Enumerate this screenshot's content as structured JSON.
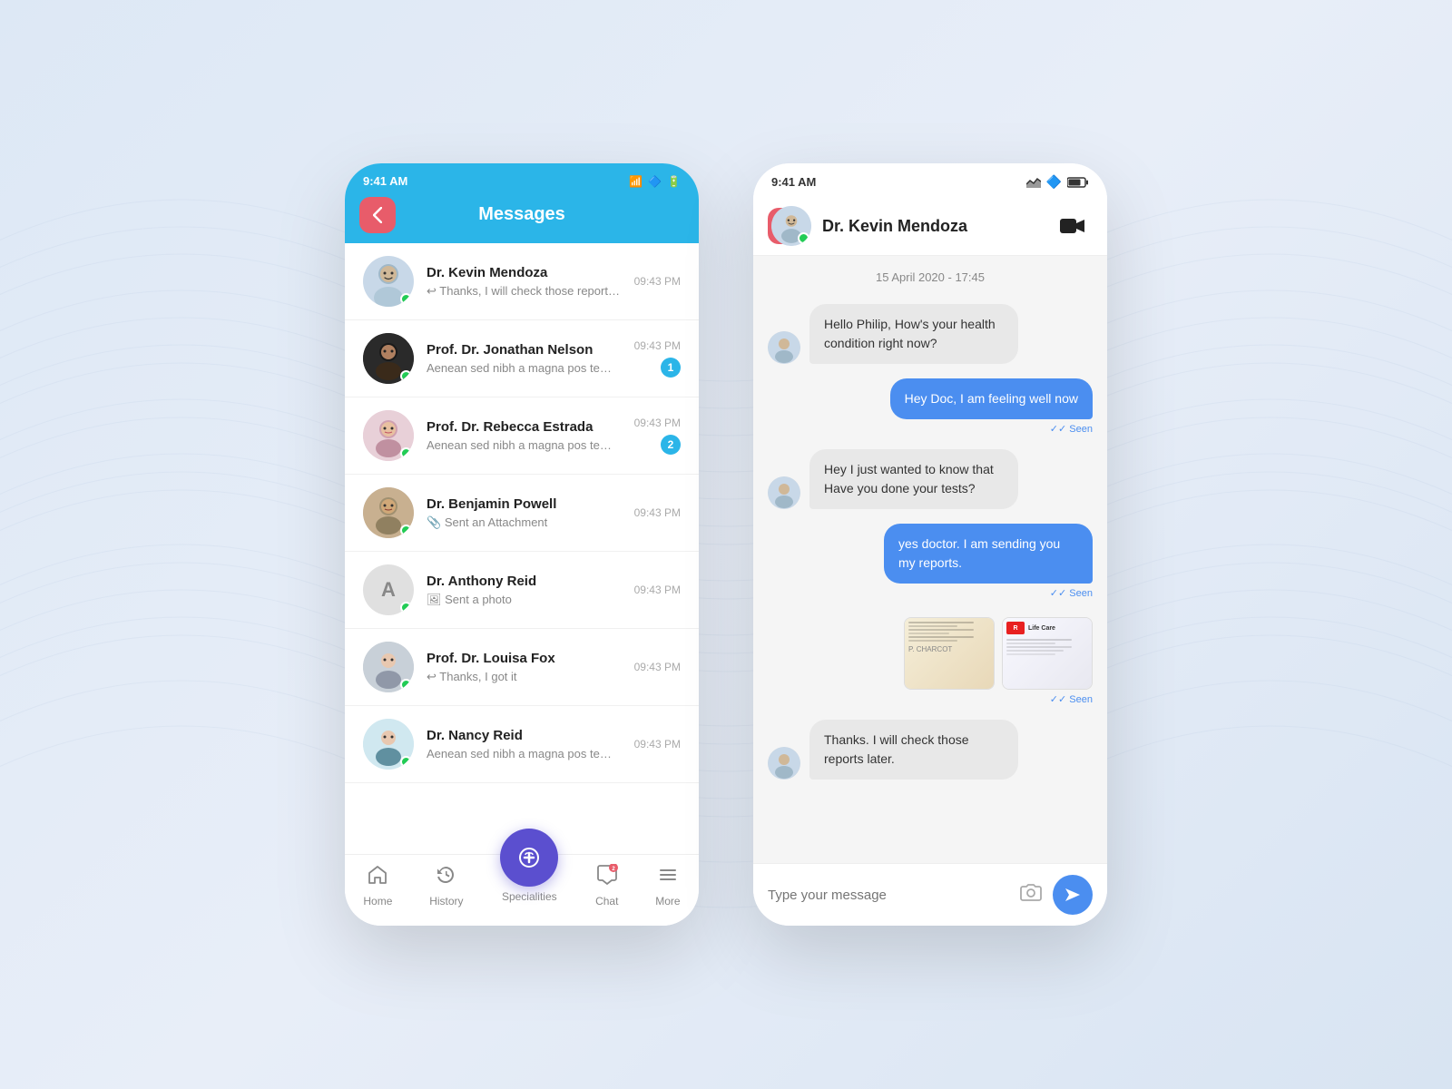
{
  "background": {
    "color": "#dde8f5"
  },
  "phone1": {
    "statusBar": {
      "time": "9:41 AM",
      "wifi": "wifi",
      "bluetooth": "bluetooth",
      "battery": "battery"
    },
    "header": {
      "title": "Messages",
      "backButton": "‹"
    },
    "messages": [
      {
        "id": 1,
        "name": "Dr. Kevin Mendoza",
        "preview": "Thanks, I will check those reports later.",
        "time": "09:43 PM",
        "unread": 0,
        "type": "reply",
        "avatarClass": "av-doctor1"
      },
      {
        "id": 2,
        "name": "Prof. Dr. Jonathan Nelson",
        "preview": "Aenean sed nibh a magna pos temnc faucibus peque nunc in aliq",
        "time": "09:43 PM",
        "unread": 1,
        "type": "text",
        "avatarClass": "av-doctor2"
      },
      {
        "id": 3,
        "name": "Prof. Dr. Rebecca Estrada",
        "preview": "Aenean sed nibh a magna pos temnc faucibus peque nunc in aliq",
        "time": "09:43 PM",
        "unread": 2,
        "type": "text",
        "avatarClass": "av-doctor3"
      },
      {
        "id": 4,
        "name": "Dr. Benjamin Powell",
        "preview": "Sent an Attachment",
        "time": "09:43 PM",
        "unread": 0,
        "type": "attach",
        "avatarClass": "av-doctor4"
      },
      {
        "id": 5,
        "name": "Dr. Anthony Reid",
        "preview": "Sent a photo",
        "time": "09:43 PM",
        "unread": 0,
        "type": "photo",
        "avatarClass": "av-doctor5",
        "initial": "A"
      },
      {
        "id": 6,
        "name": "Prof. Dr. Louisa Fox",
        "preview": "Thanks, I got it",
        "time": "09:43 PM",
        "unread": 0,
        "type": "reply",
        "avatarClass": "av-doctor6"
      },
      {
        "id": 7,
        "name": "Dr. Nancy Reid",
        "preview": "Aenean sed nibh a magna pos temnc faucibus peque nunc in aliq",
        "time": "09:43 PM",
        "unread": 0,
        "type": "text",
        "avatarClass": "av-doctor7"
      }
    ],
    "bottomNav": {
      "items": [
        {
          "label": "Home",
          "icon": "🏠",
          "active": false
        },
        {
          "label": "History",
          "icon": "🩺",
          "active": false
        },
        {
          "label": "Specialities",
          "icon": "🔵",
          "active": true,
          "center": true
        },
        {
          "label": "Chat",
          "icon": "💬",
          "active": false,
          "badge": 2
        },
        {
          "label": "More",
          "icon": "☰",
          "active": false
        }
      ]
    }
  },
  "phone2": {
    "statusBar": {
      "time": "9:41 AM"
    },
    "header": {
      "doctorName": "Dr. Kevin Mendoza",
      "backButton": "‹"
    },
    "chat": {
      "dateSeparator": "15 April 2020 - 17:45",
      "messages": [
        {
          "id": 1,
          "direction": "incoming",
          "text": "Hello Philip, How's your health condition right now?",
          "seen": false
        },
        {
          "id": 2,
          "direction": "outgoing",
          "text": "Hey Doc, I am feeling well now",
          "seen": true
        },
        {
          "id": 3,
          "direction": "incoming",
          "text": "Hey I just wanted to know that Have you done your tests?",
          "seen": false
        },
        {
          "id": 4,
          "direction": "outgoing",
          "text": "yes doctor. I am sending you my reports.",
          "seen": true
        },
        {
          "id": 5,
          "direction": "outgoing",
          "type": "images",
          "seen": true
        },
        {
          "id": 6,
          "direction": "incoming",
          "text": "Thanks. I will check those reports later.",
          "seen": false
        }
      ]
    },
    "inputBar": {
      "placeholder": "Type your message"
    }
  }
}
